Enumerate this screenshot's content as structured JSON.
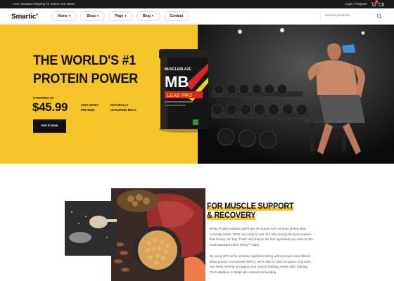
{
  "topbar": {
    "shipping_text": "Free standard shipping for orders over $340.",
    "account_text": "Login / Register",
    "cart_count": "0"
  },
  "header": {
    "logo": "Smartic",
    "nav": [
      {
        "label": "Home",
        "chevron": "▾"
      },
      {
        "label": "Shop",
        "chevron": "▾"
      },
      {
        "label": "Page",
        "chevron": "▾"
      },
      {
        "label": "Blog",
        "chevron": "▾"
      },
      {
        "label": "Contact",
        "chevron": ""
      }
    ],
    "search_placeholder": "Search products..."
  },
  "hero": {
    "title_line1": "THE WORLD'S #1",
    "title_line2": "PROTEIN POWER",
    "starting_at": "STARTING AT",
    "price": "$45.99",
    "feature1_line1": "100% WHEY",
    "feature1_line2": "PROTEIN",
    "feature2_line1": "NATURALLY",
    "feature2_line2": "OCCURING BCCA",
    "cta": "Get It Now",
    "tub_brand": "MUSCLEBLAZE",
    "tub_logo": "MB",
    "tub_product": "LEAD PRO"
  },
  "section": {
    "title_line1": "FOR MUSCLE SUPPORT",
    "title_line2": "& RECOVERY",
    "para1": "Whey Protein Isolates (WPI) are the purest form of whey protein that currently exists. WPIs are costly to use, but rate among the best proteins that money can buy. That's why they're the first ingredient you read on the Gold Standard 100% Whey™ label.",
    "para2": "By using WPI as the primary ingredient along with premium ultra-filtered whey protein concentrate (WPC), we're able to pack 24 grams of protein into every serving to support your muscle building needs after training. ON's attention to detail also extends to banding"
  },
  "colors": {
    "accent": "#f7c429",
    "dark": "#111111",
    "topbar": "#1a1a1a"
  }
}
